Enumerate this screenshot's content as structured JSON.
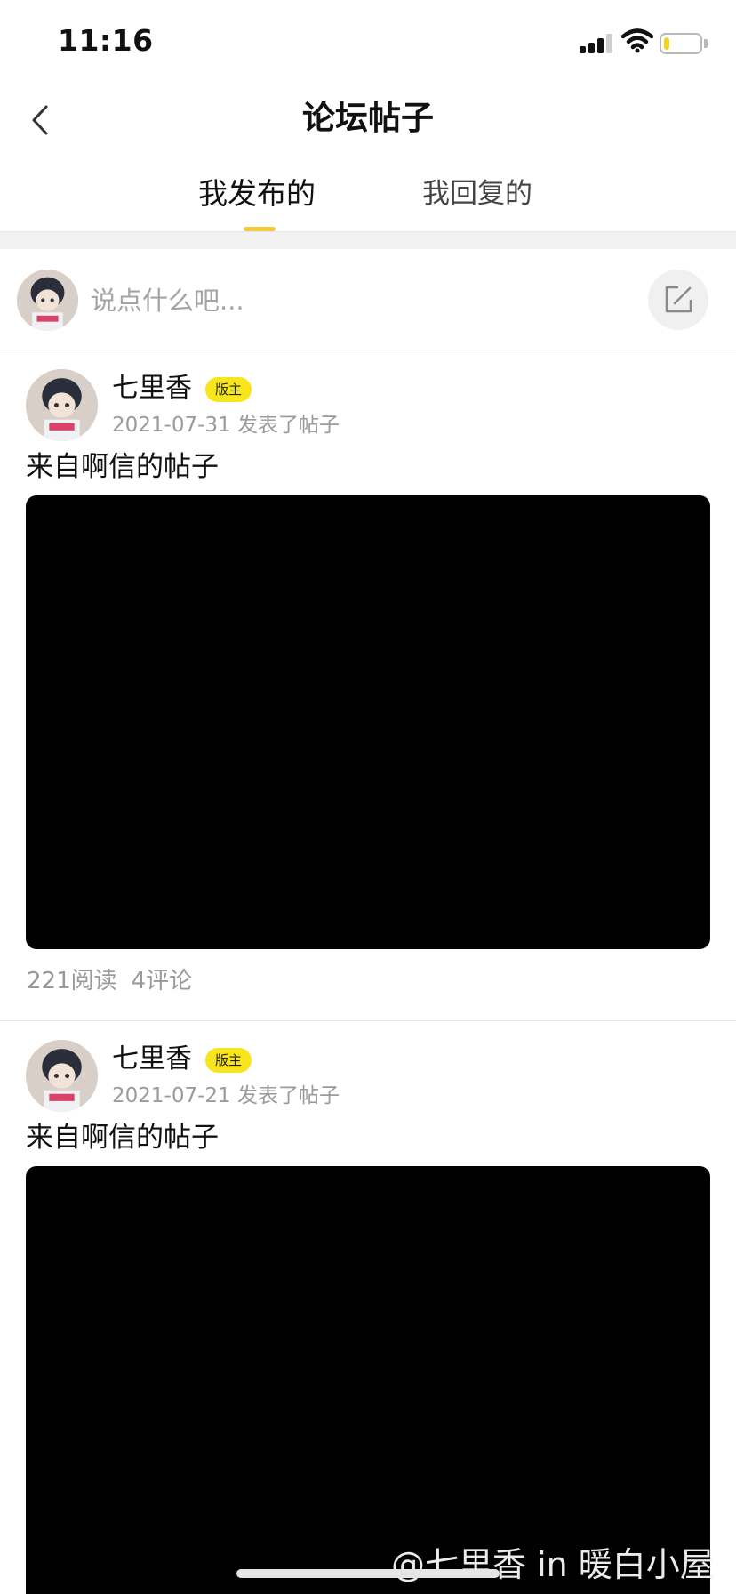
{
  "status_bar": {
    "time": "11:16",
    "battery_level": 0.15
  },
  "nav": {
    "title": "论坛帖子",
    "back_icon": "chevron-left-icon"
  },
  "tabs": [
    {
      "label": "我发布的",
      "active": true
    },
    {
      "label": "我回复的",
      "active": false
    }
  ],
  "composer": {
    "placeholder": "说点什么吧...",
    "edit_icon": "edit-square-icon"
  },
  "posts": [
    {
      "author": "七里香",
      "badge": "版主",
      "meta": "2021-07-31 发表了帖子",
      "title": "来自啊信的帖子",
      "reads": "221阅读",
      "comments": "4评论"
    },
    {
      "author": "七里香",
      "badge": "版主",
      "meta": "2021-07-21 发表了帖子",
      "title": "来自啊信的帖子"
    }
  ],
  "watermark": "@七里香 in 暖白小屋",
  "colors": {
    "accent": "#f4cb3a",
    "badge": "#f7e51d",
    "battery": "#f4d21a"
  }
}
